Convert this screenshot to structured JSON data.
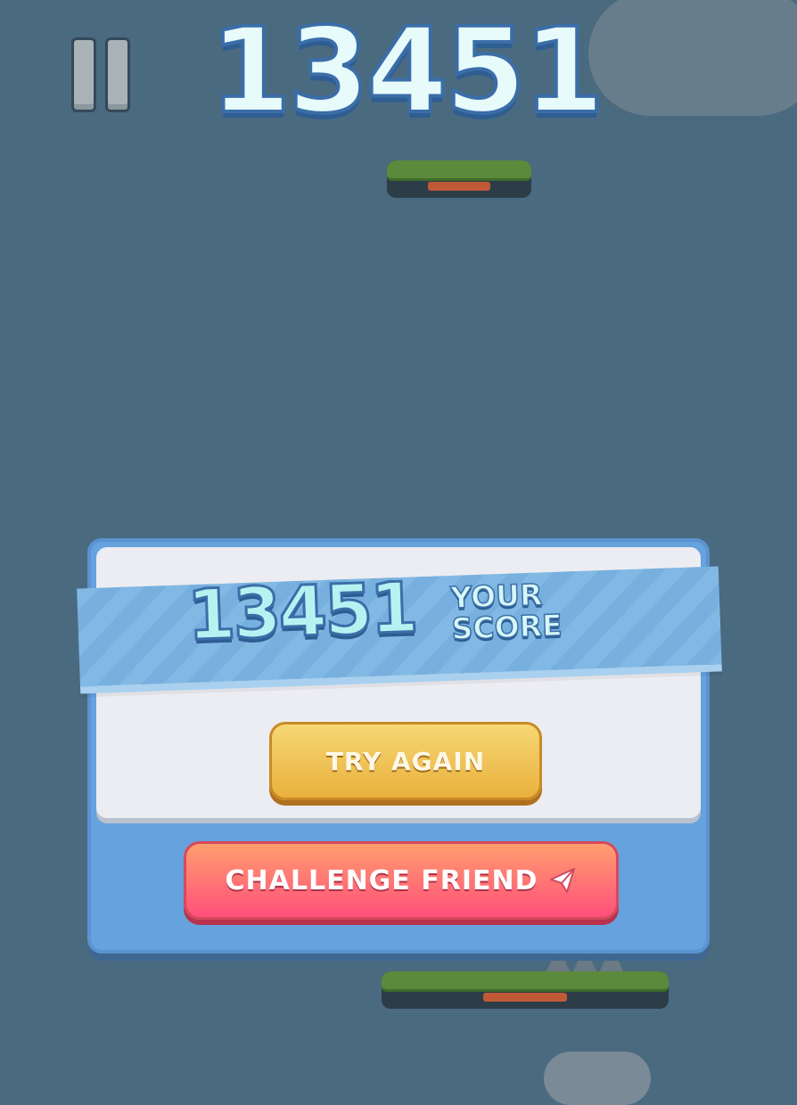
{
  "hud": {
    "score": "13451",
    "pause_icon": "pause-icon"
  },
  "result_panel": {
    "score": "13451",
    "label_line1": "YOUR",
    "label_line2": "SCORE",
    "try_again_label": "TRY AGAIN",
    "challenge_label": "CHALLENGE FRIEND",
    "challenge_icon": "send-icon"
  },
  "colors": {
    "background": "#4a6a80",
    "panel": "#66a2dd",
    "try_again": "#f0c04f",
    "challenge": "#ff6a74"
  }
}
